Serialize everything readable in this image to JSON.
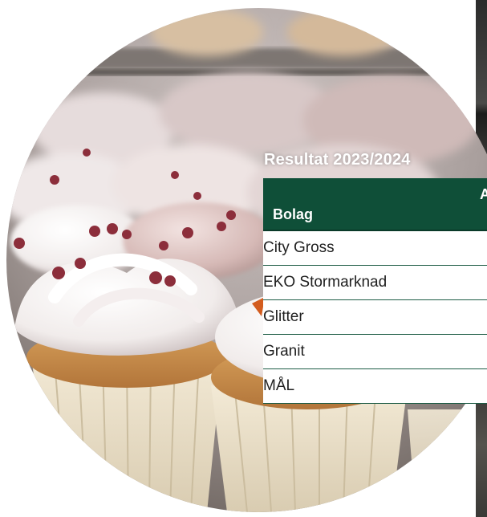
{
  "heading": "Resultat 2023/2024",
  "table": {
    "header_company": "Bolag",
    "header_partial": "A",
    "rows": [
      "City Gross",
      "EKO Stormarknad",
      "Glitter",
      "Granit",
      "MÅL"
    ]
  },
  "colors": {
    "header_bg": "#0f4f38",
    "row_border": "#1d5c45"
  },
  "image": {
    "subject": "cupcakes with white and pink frosting and red sugar pearls",
    "shape": "circle-crop"
  }
}
